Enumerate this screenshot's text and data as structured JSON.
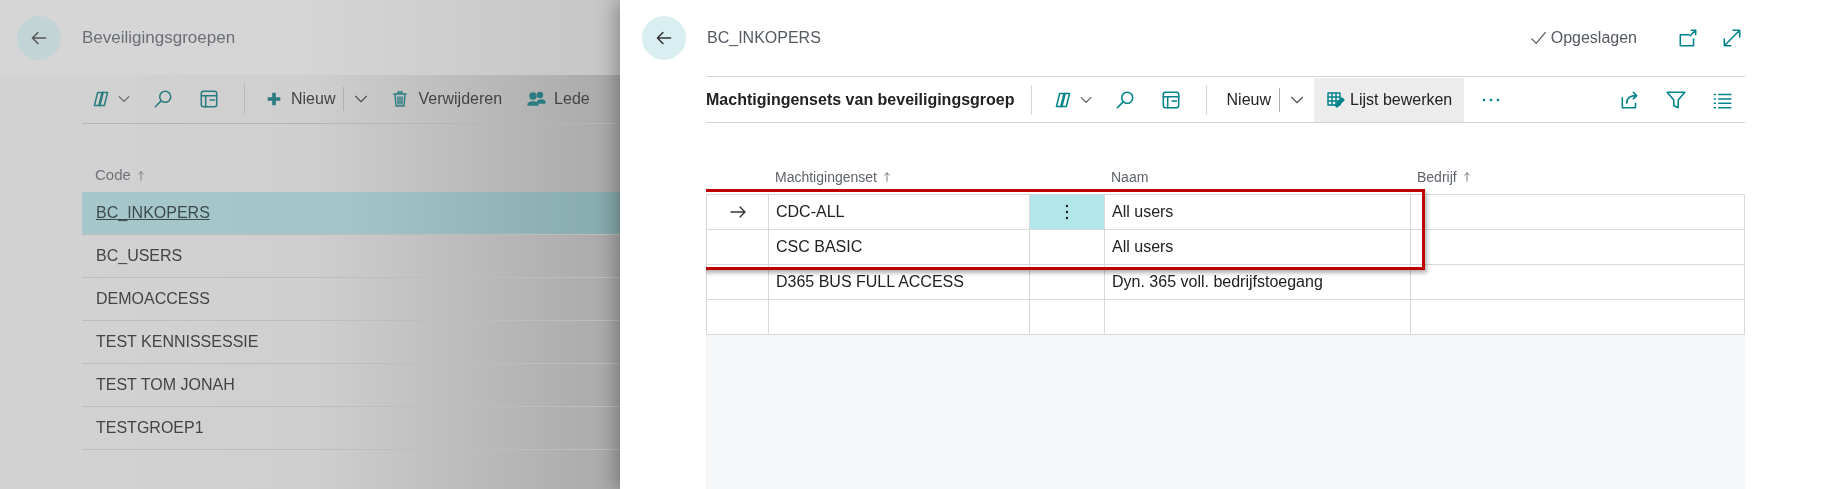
{
  "list_page": {
    "title": "Beveiligingsgroepen",
    "actions": [
      {
        "kind": "copilot"
      },
      {
        "kind": "search"
      },
      {
        "kind": "layout"
      },
      {
        "kind": "new",
        "label": "Nieuw"
      },
      {
        "kind": "delete",
        "label": "Verwijderen"
      },
      {
        "kind": "members",
        "label": "Lede"
      }
    ],
    "columns": [
      {
        "label": "Code",
        "sorted": true
      }
    ],
    "rows": [
      {
        "code": "BC_INKOPERS",
        "selected": true
      },
      {
        "code": "BC_USERS",
        "selected": false
      },
      {
        "code": "DEMOACCESS",
        "selected": false
      },
      {
        "code": "TEST KENNISSESSIE",
        "selected": false
      },
      {
        "code": "TEST TOM JONAH",
        "selected": false
      },
      {
        "code": "TESTGROEP1",
        "selected": false
      }
    ]
  },
  "card": {
    "title": "BC_INKOPERS",
    "save_status": "Opgeslagen",
    "part": {
      "title": "Machtigingensets van beveiligingsgroep",
      "actions": [
        {
          "kind": "copilot"
        },
        {
          "kind": "search"
        },
        {
          "kind": "layout"
        },
        {
          "kind": "new",
          "label": "Nieuw"
        },
        {
          "kind": "edit-list",
          "label": "Lijst bewerken",
          "selected": true
        },
        {
          "kind": "more"
        },
        {
          "kind": "share"
        },
        {
          "kind": "filter"
        },
        {
          "kind": "list"
        }
      ],
      "columns": [
        {
          "label": "Machtigingenset",
          "sorted": true
        },
        {
          "label": "Naam",
          "sorted": false
        },
        {
          "label": "Bedrijf",
          "sorted": true
        }
      ],
      "highlight_box": {
        "rows": [
          {
            "permission_set": "CDC-ALL",
            "name": "All users",
            "current": true
          },
          {
            "permission_set": "CSC BASIC",
            "name": "All users",
            "current": false
          }
        ]
      },
      "rows": [
        {
          "permission_set": "D365 BUS FULL ACCESS",
          "name": "Dyn. 365 voll. bedrijfstoegang",
          "current": false
        },
        {
          "current": false
        }
      ]
    }
  }
}
